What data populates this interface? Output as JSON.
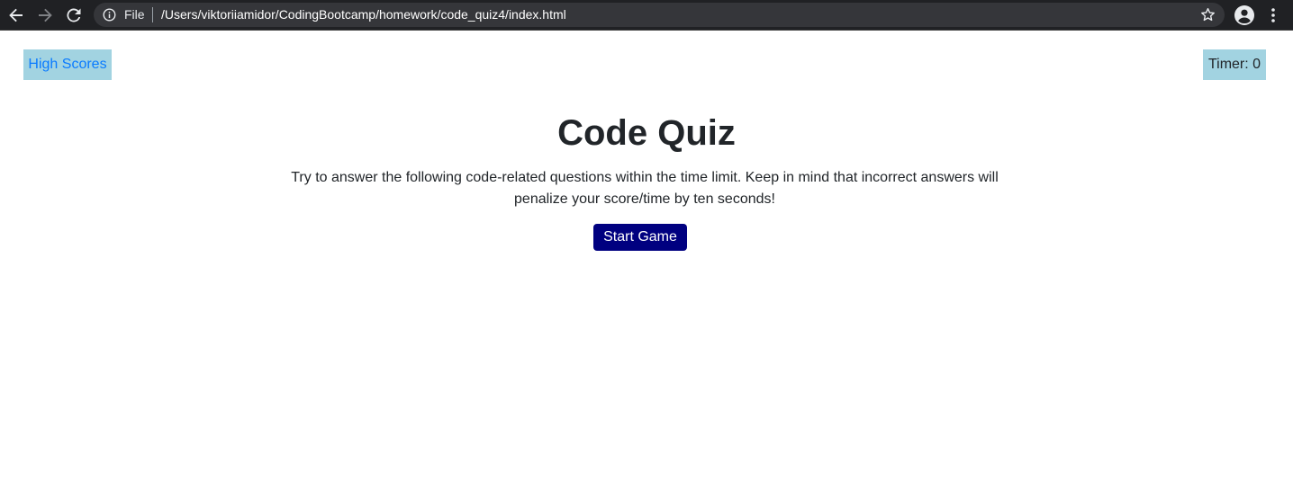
{
  "browser": {
    "scheme_label": "File",
    "url": "/Users/viktoriiamidor/CodingBootcamp/homework/code_quiz4/index.html",
    "icons": [
      "back-icon",
      "forward-icon",
      "reload-icon",
      "info-icon",
      "star-icon",
      "profile-icon",
      "menu-icon"
    ]
  },
  "page": {
    "high_scores_label": "High Scores",
    "timer_text": "Timer: 0",
    "title": "Code Quiz",
    "description": "Try to answer the following code-related questions within the time limit. Keep in mind that incorrect answers will penalize your score/time by ten seconds!",
    "start_button_label": "Start Game"
  },
  "colors": {
    "browser_bar": "#202124",
    "omnibox": "#35363a",
    "header_box": "#a2d3e1",
    "link": "#0a7bff",
    "start_button": "#000080",
    "text": "#212529"
  }
}
